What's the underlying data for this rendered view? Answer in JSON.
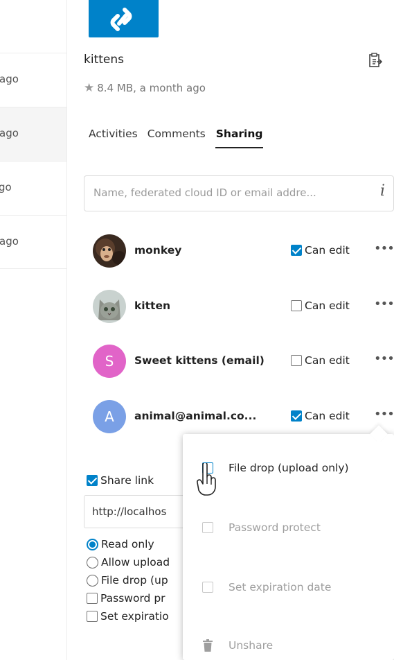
{
  "file_list": {
    "rows": [
      {
        "time": "ago",
        "selected": false
      },
      {
        "time": "ago",
        "selected": true
      },
      {
        "time": "go",
        "selected": false
      },
      {
        "time": "ago",
        "selected": false
      }
    ]
  },
  "sidebar": {
    "file_name": "kittens",
    "file_meta": "8.4 MB, a month ago",
    "tabs": [
      {
        "label": "Activities",
        "active": false
      },
      {
        "label": "Comments",
        "active": false
      },
      {
        "label": "Sharing",
        "active": true
      }
    ],
    "search_placeholder": "Name, federated cloud ID or email addre...",
    "info_glyph": "i",
    "shares": [
      {
        "name": "monkey",
        "avatar": "photo-monkey",
        "can_edit_label": "Can edit",
        "can_edit": true
      },
      {
        "name": "kitten",
        "avatar": "photo-kitten",
        "can_edit_label": "Can edit",
        "can_edit": false
      },
      {
        "name": "Sweet kittens (email)",
        "avatar_letter": "S",
        "avatar_color": "#e164c8",
        "can_edit_label": "Can edit",
        "can_edit": false
      },
      {
        "name": "animal@animal.co...",
        "avatar_letter": "A",
        "avatar_color": "#7aa0e6",
        "can_edit_label": "Can edit",
        "can_edit": true
      }
    ],
    "share_link_label": "Share link",
    "share_link_checked": true,
    "share_link_url": "http://localhos",
    "link_options": [
      {
        "label": "Read only",
        "type": "radio",
        "checked": true
      },
      {
        "label": "Allow upload",
        "type": "radio",
        "checked": false
      },
      {
        "label": "File drop (up",
        "type": "radio",
        "checked": false
      },
      {
        "label": "Password pr",
        "type": "checkbox",
        "checked": false
      },
      {
        "label": "Set expiratio",
        "type": "checkbox",
        "checked": false
      }
    ]
  },
  "popover_menu": {
    "items": [
      {
        "label": "File drop (upload only)",
        "icon": "checkbox",
        "disabled": false
      },
      {
        "label": "Password protect",
        "icon": "checkbox",
        "disabled": true
      },
      {
        "label": "Set expiration date",
        "icon": "checkbox",
        "disabled": true
      },
      {
        "label": "Unshare",
        "icon": "trash-icon",
        "disabled": true
      }
    ]
  },
  "colors": {
    "accent": "#0082c9",
    "thumbnail": "#0082c9"
  }
}
